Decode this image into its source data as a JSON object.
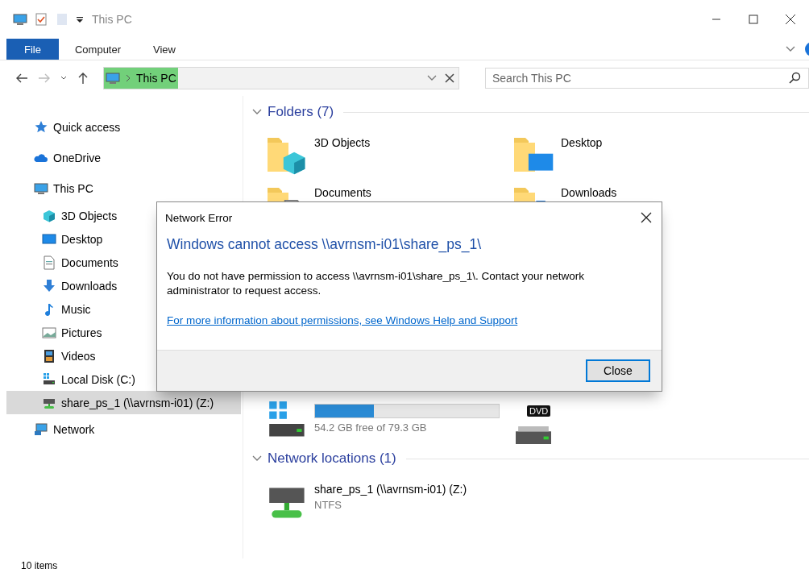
{
  "window": {
    "title": "This PC"
  },
  "ribbon": {
    "tabs": [
      {
        "label": "File",
        "selected": true
      },
      {
        "label": "Computer",
        "selected": false
      },
      {
        "label": "View",
        "selected": false
      }
    ]
  },
  "address": {
    "path": "This PC",
    "search": {
      "placeholder": "Search This PC"
    }
  },
  "sidebar": {
    "items": [
      {
        "label": "Quick access",
        "selected": false
      },
      {
        "label": "OneDrive",
        "selected": false
      },
      {
        "label": "This PC",
        "selected": false,
        "children": [
          {
            "label": "3D Objects",
            "selected": false
          },
          {
            "label": "Desktop",
            "selected": false
          },
          {
            "label": "Documents",
            "selected": false
          },
          {
            "label": "Downloads",
            "selected": false
          },
          {
            "label": "Music",
            "selected": false
          },
          {
            "label": "Pictures",
            "selected": false
          },
          {
            "label": "Videos",
            "selected": false
          },
          {
            "label": "Local Disk (C:)",
            "selected": false
          },
          {
            "label": "share_ps_1 (\\\\avrnsm-i01) (Z:)",
            "selected": true
          }
        ]
      },
      {
        "label": "Network",
        "selected": false
      }
    ]
  },
  "groups": [
    {
      "title": "Folders (7)",
      "expanded": true,
      "items": [
        {
          "kind": "folder",
          "name": "3D Objects"
        },
        {
          "kind": "folder",
          "name": "Desktop"
        },
        {
          "kind": "folder",
          "name": "Documents"
        },
        {
          "kind": "folder",
          "name": "Downloads"
        }
      ]
    },
    {
      "items": [
        {
          "kind": "drive",
          "level": 0.32,
          "detail": "54.2 GB free of 79.3 GB"
        },
        {
          "kind": "drive",
          "badge": "DVD"
        }
      ]
    },
    {
      "title": "Network locations (1)",
      "expanded": true,
      "items": [
        {
          "kind": "drive",
          "name": "share_ps_1 (\\\\avrnsm-i01) (Z:)",
          "detail": "NTFS"
        }
      ]
    }
  ],
  "status_bar": {
    "count": "10 items"
  },
  "dialog": {
    "title": "Network Error",
    "heading": "Windows cannot access \\\\avrnsm-i01\\share_ps_1\\",
    "message": "You do not have permission to access \\\\avrnsm-i01\\share_ps_1\\. Contact your network administrator to request access.",
    "link": "For more information about permissions, see Windows Help and Support",
    "buttons": [
      "Close"
    ]
  }
}
